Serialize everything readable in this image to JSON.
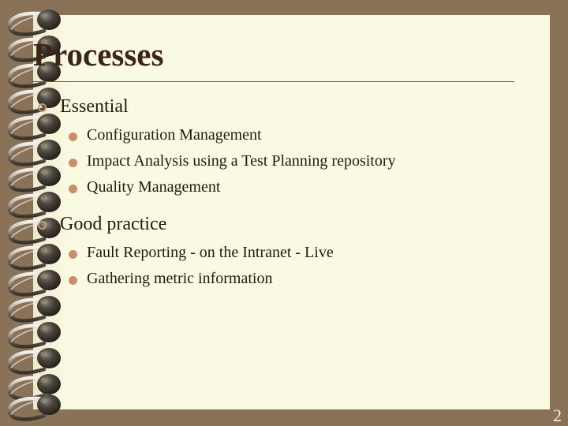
{
  "slide": {
    "title": "Processes",
    "page_number": "2",
    "colors": {
      "background": "#8a7258",
      "paper": "#fafae2",
      "title_text": "#3c2417",
      "body_text": "#241b0e",
      "rule": "#6b5a43",
      "bullet_level1": "#c49a74",
      "bullet_level2": "#c8906a",
      "page_number_text": "#f6f3dc"
    }
  },
  "content": {
    "groups": [
      {
        "heading": "Essential",
        "items": [
          "Configuration Management",
          "Impact Analysis using a Test Planning repository",
          "Quality Management"
        ]
      },
      {
        "heading": "Good practice",
        "items": [
          "Fault Reporting - on the Intranet - Live",
          "Gathering metric information"
        ]
      }
    ]
  }
}
